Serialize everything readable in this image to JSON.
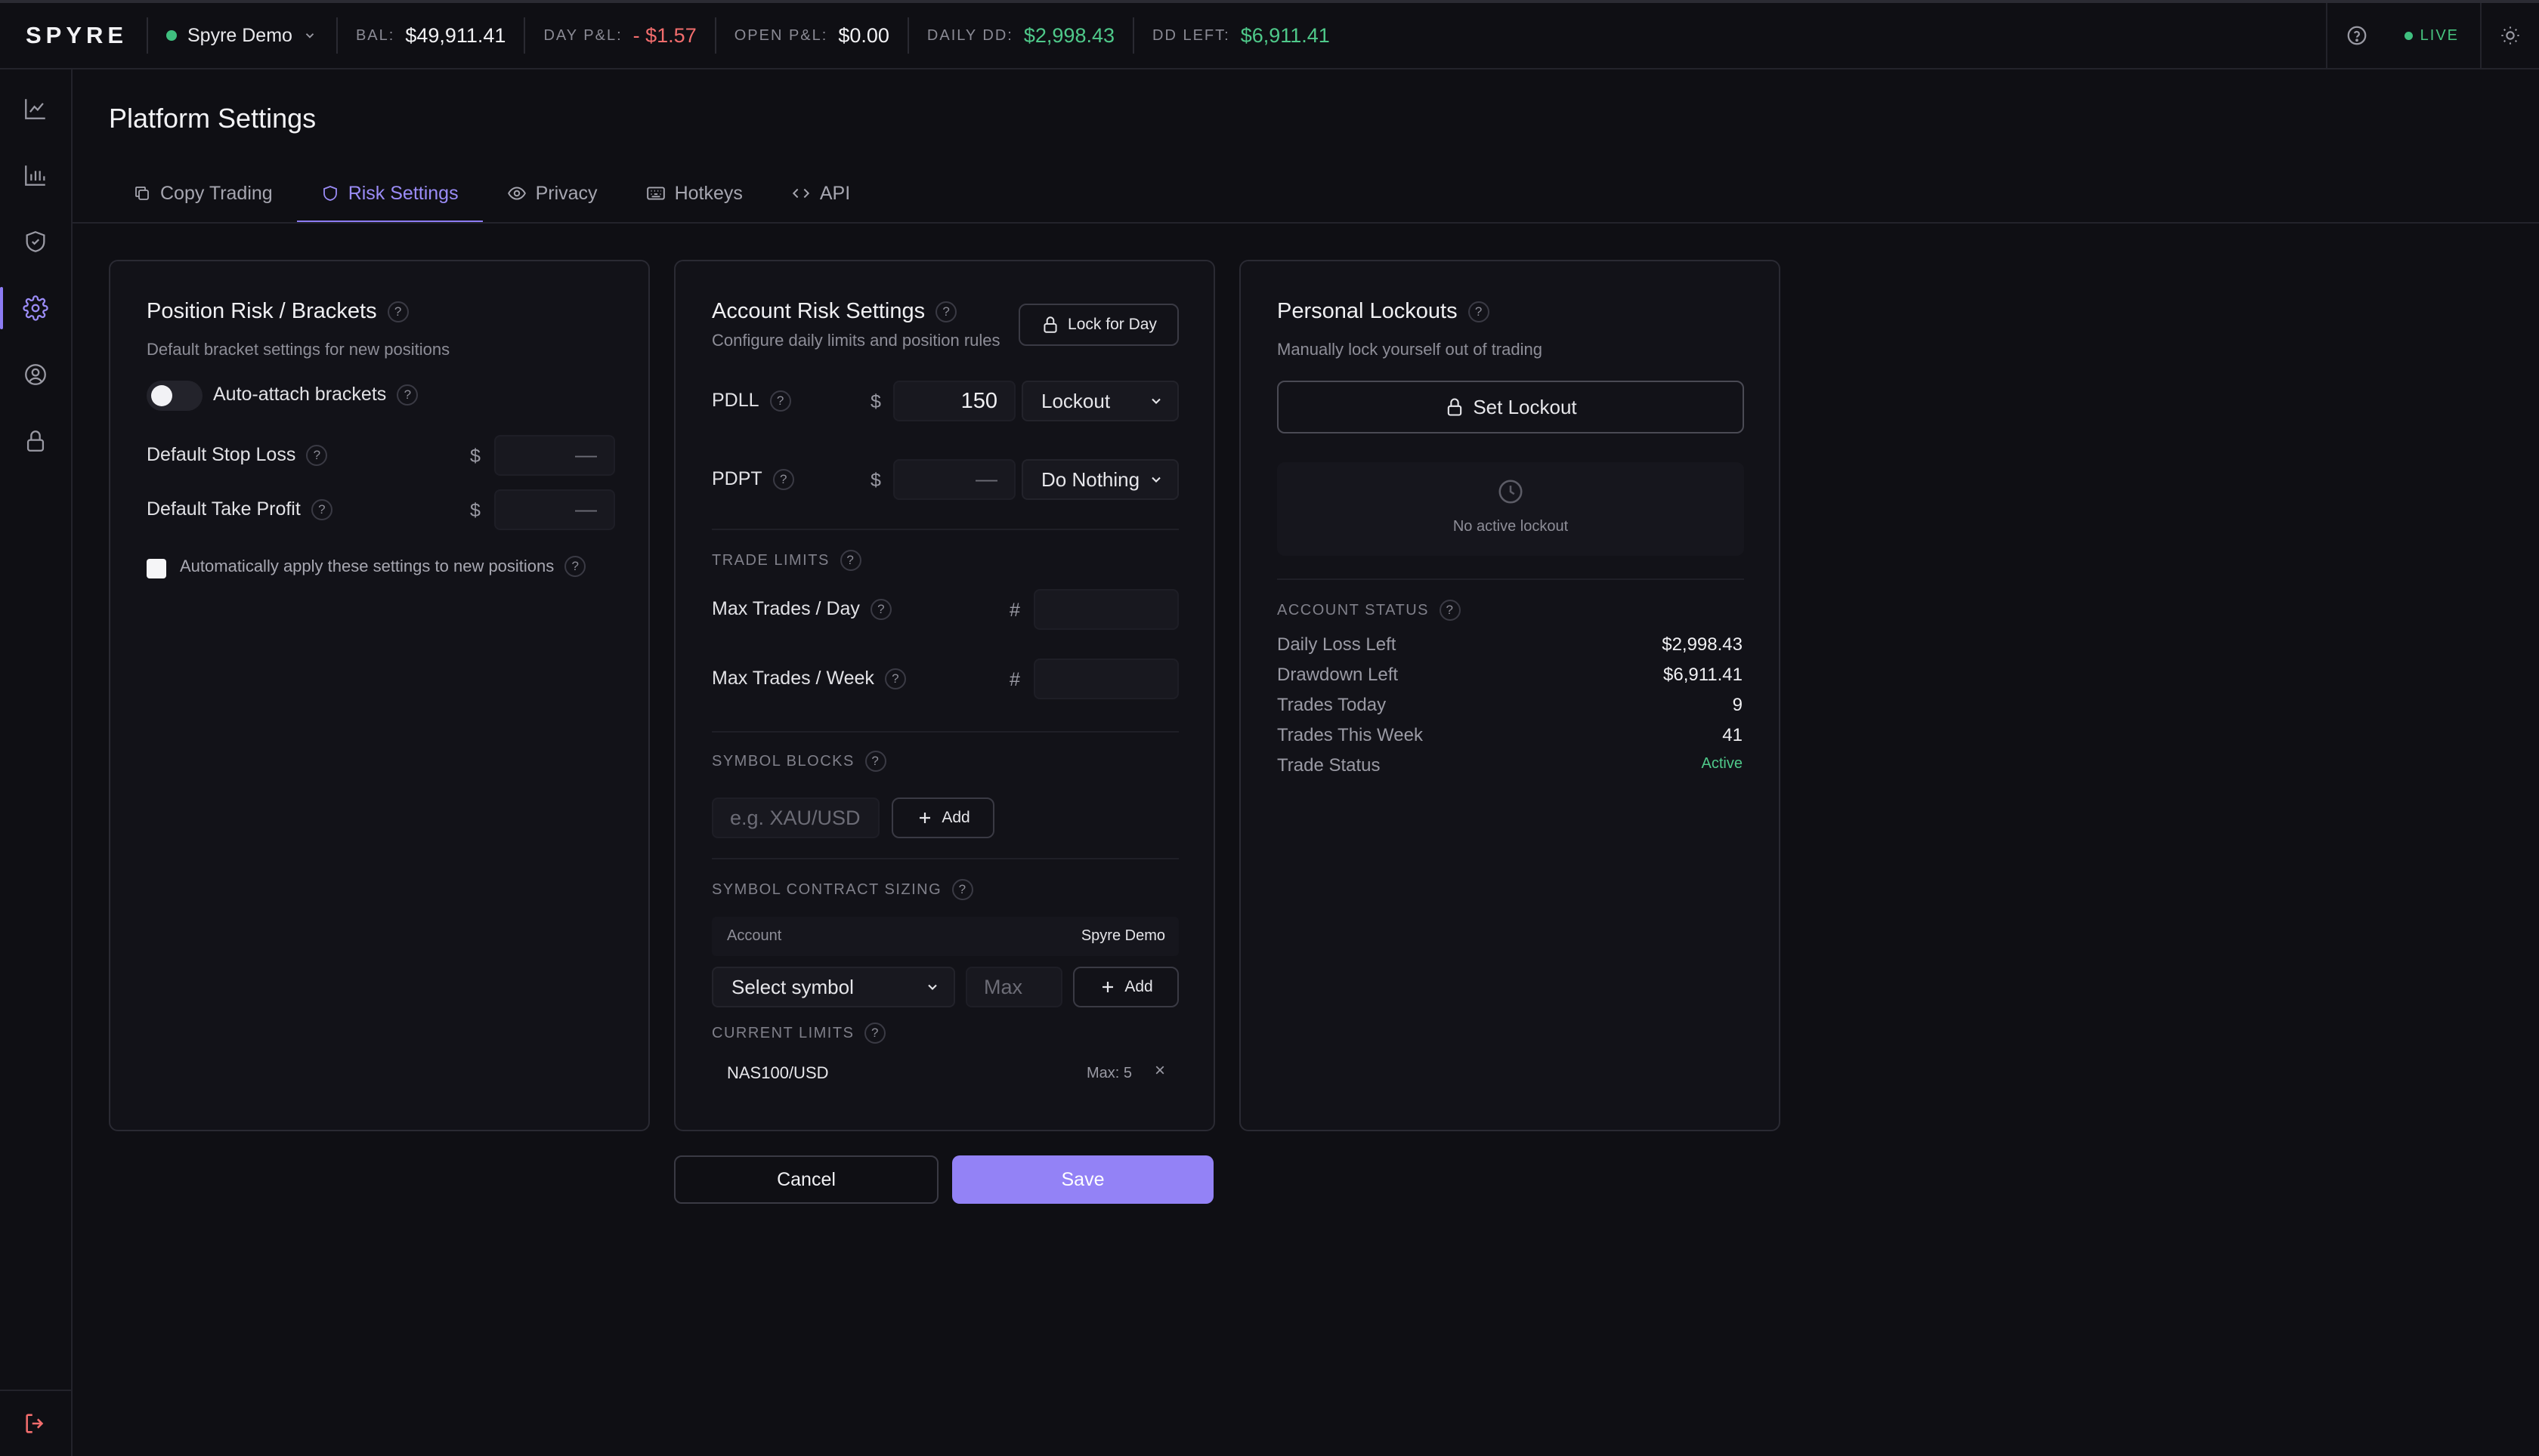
{
  "colors": {
    "accent": "#8d7cf4",
    "positive": "#4fc98a",
    "negative": "#f26d6d",
    "background": "#0f0f14",
    "panel": "#121218"
  },
  "topbar": {
    "logo": "SPYRE",
    "account_name": "Spyre Demo",
    "stats": [
      {
        "label": "BAL:",
        "value": "$49,911.41",
        "tone": "neutral"
      },
      {
        "label": "DAY P&L:",
        "value": "- $1.57",
        "tone": "neg"
      },
      {
        "label": "OPEN P&L:",
        "value": "$0.00",
        "tone": "neutral"
      },
      {
        "label": "DAILY DD:",
        "value": "$2,998.43",
        "tone": "pos"
      },
      {
        "label": "DD LEFT:",
        "value": "$6,911.41",
        "tone": "pos"
      }
    ],
    "live_label": "LIVE",
    "icons": [
      "help-circle-icon",
      "sun-icon"
    ]
  },
  "sidebar": {
    "items": [
      "line-chart-icon",
      "bar-chart-icon",
      "shield-check-icon",
      "gear-icon",
      "user-circle-icon",
      "lock-icon"
    ],
    "active_index": 3,
    "bottom_icon": "logout-icon"
  },
  "page": {
    "title": "Platform Settings",
    "tabs": [
      {
        "label": "Copy Trading",
        "icon": "copy-icon"
      },
      {
        "label": "Risk Settings",
        "icon": "shield-icon"
      },
      {
        "label": "Privacy",
        "icon": "eye-icon"
      },
      {
        "label": "Hotkeys",
        "icon": "keyboard-icon"
      },
      {
        "label": "API",
        "icon": "code-icon"
      }
    ],
    "active_tab": "Risk Settings"
  },
  "position_panel": {
    "title": "Position Risk / Brackets",
    "subtitle": "Default bracket settings for new positions",
    "auto_attach_label": "Auto-attach brackets",
    "auto_attach_on": false,
    "stop_loss_label": "Default Stop Loss",
    "stop_loss_value": "—",
    "take_profit_label": "Default Take Profit",
    "take_profit_value": "—",
    "currency": "$",
    "auto_apply_label": "Automatically apply these settings to new positions",
    "auto_apply_checked": false
  },
  "account_panel": {
    "title": "Account Risk Settings",
    "subtitle": "Configure daily limits and position rules",
    "lock_button": "Lock for Day",
    "currency": "$",
    "pdll_label": "PDLL",
    "pdll_value": "150",
    "pdll_action": "Lockout",
    "pdpt_label": "PDPT",
    "pdpt_value": "—",
    "pdpt_action": "Do Nothing",
    "trade_limits_label": "TRADE LIMITS",
    "hash": "#",
    "max_day_label": "Max Trades / Day",
    "max_week_label": "Max Trades / Week",
    "symbol_blocks_label": "SYMBOL BLOCKS",
    "symbol_placeholder": "e.g. XAU/USD",
    "add_label": "Add",
    "sizing_label": "SYMBOL CONTRACT SIZING",
    "account_col_label": "Account",
    "account_col_value": "Spyre Demo",
    "select_symbol": "Select symbol",
    "max_placeholder": "Max",
    "current_limits_label": "CURRENT LIMITS",
    "limits": [
      {
        "symbol": "NAS100/USD",
        "max": "Max: 5"
      }
    ]
  },
  "lockouts_panel": {
    "title": "Personal Lockouts",
    "subtitle": "Manually lock yourself out of trading",
    "set_lockout": "Set Lockout",
    "empty_text": "No active lockout",
    "status_label": "ACCOUNT STATUS",
    "status": [
      {
        "k": "Daily Loss Left",
        "v": "$2,998.43"
      },
      {
        "k": "Drawdown Left",
        "v": "$6,911.41"
      },
      {
        "k": "Trades Today",
        "v": "9"
      },
      {
        "k": "Trades This Week",
        "v": "41"
      },
      {
        "k": "Trade Status",
        "v": "Active"
      }
    ]
  },
  "footer": {
    "cancel": "Cancel",
    "save": "Save"
  }
}
